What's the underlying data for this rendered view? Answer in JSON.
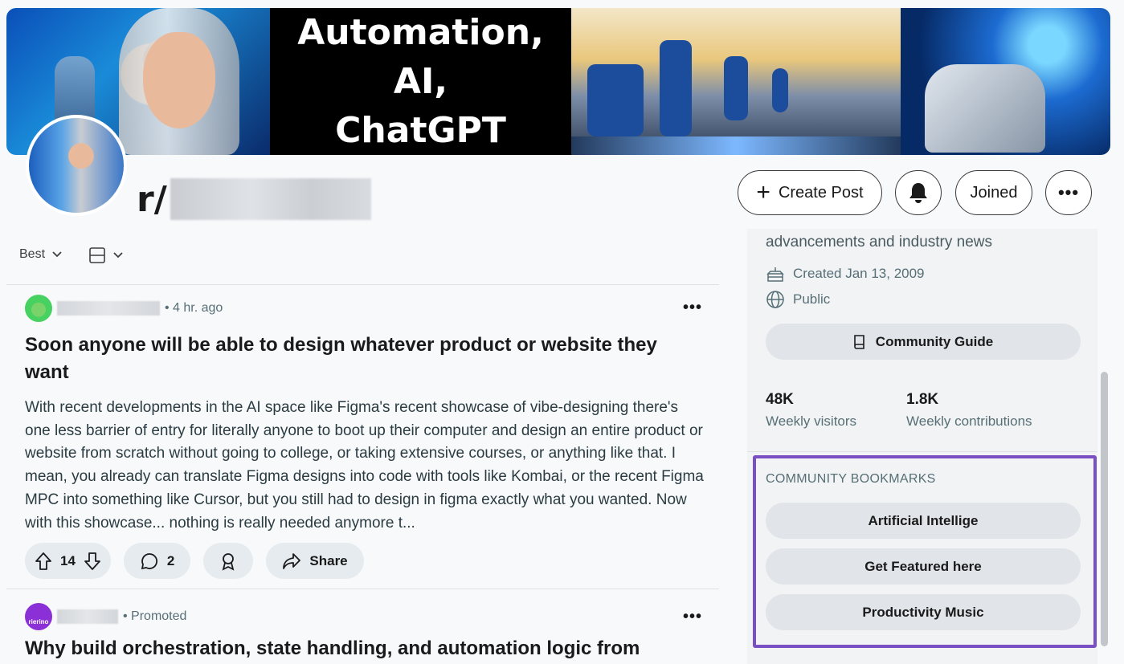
{
  "banner": {
    "title_lines": [
      "Automation,",
      "AI,",
      "ChatGPT"
    ]
  },
  "subreddit": {
    "prefix": "r/"
  },
  "header_buttons": {
    "create_post": "Create Post",
    "joined": "Joined",
    "more": "•••"
  },
  "feed": {
    "sort_label": "Best"
  },
  "posts": [
    {
      "time": "• 4 hr. ago",
      "title": "Soon anyone will be able to design whatever product or website they want",
      "body": "With recent developments in the AI space like Figma's recent showcase of vibe-designing there's one less barrier of entry for literally anyone to boot up their computer and design an entire product or website from scratch without going to college, or taking extensive courses, or anything like that. I mean, you already can translate Figma designs into code with tools like Kombai, or the recent Figma MPC into something like Cursor, but you still had to design in figma exactly what you wanted. Now with this showcase... nothing is really needed anymore t...",
      "votes": "14",
      "comments": "2",
      "share": "Share",
      "more": "•••"
    },
    {
      "avatar_text": "rierino",
      "time": "• Promoted",
      "title": "Why build orchestration, state handling, and automation logic from",
      "more": "•••"
    }
  ],
  "sidebar": {
    "description_tail": "advancements and industry news",
    "created": "Created Jan 13, 2009",
    "visibility": "Public",
    "guide_button": "Community Guide",
    "stats": [
      {
        "value": "48K",
        "label": "Weekly visitors"
      },
      {
        "value": "1.8K",
        "label": "Weekly contributions"
      }
    ],
    "bookmarks": {
      "heading": "COMMUNITY BOOKMARKS",
      "items": [
        "Artificial Intellige",
        "Get Featured here",
        "Productivity Music"
      ]
    }
  },
  "colors": {
    "bookmark_highlight": "#7a4fc4",
    "pill_bg": "#e5ebee",
    "upvote_avatar": "#46d160",
    "promoted_avatar": "#8b2fd6"
  }
}
